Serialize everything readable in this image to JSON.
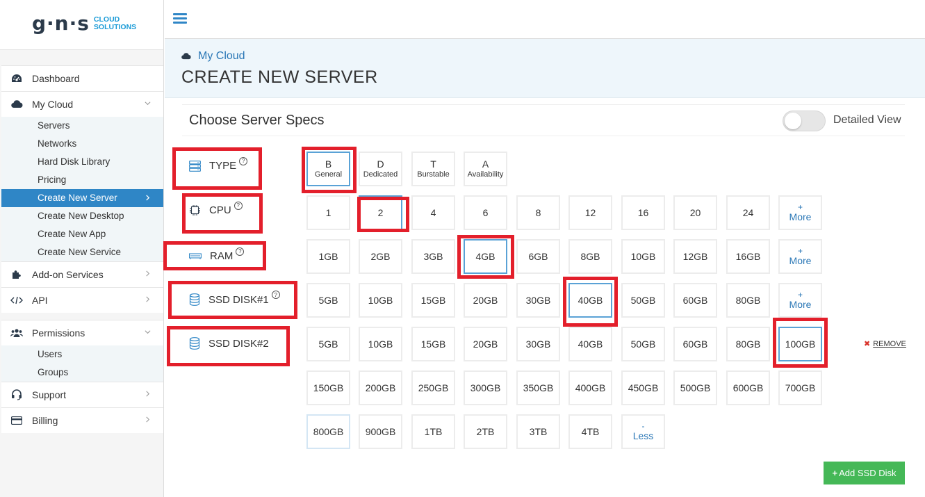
{
  "logo": {
    "brand": "g·n·s",
    "line1": "CLOUD",
    "line2": "SOLUTIONS"
  },
  "sidebar": {
    "items": [
      {
        "label": "Dashboard"
      },
      {
        "label": "My Cloud"
      },
      {
        "label": "Add-on Services"
      },
      {
        "label": "API"
      },
      {
        "label": "Permissions"
      },
      {
        "label": "Support"
      },
      {
        "label": "Billing"
      }
    ],
    "mycloud_sub": [
      "Servers",
      "Networks",
      "Hard Disk Library",
      "Pricing",
      "Create New Server",
      "Create New Desktop",
      "Create New App",
      "Create New Service"
    ],
    "permissions_sub": [
      "Users",
      "Groups"
    ]
  },
  "header": {
    "breadcrumb": "My Cloud",
    "title": "CREATE NEW SERVER"
  },
  "specs": {
    "title": "Choose Server Specs",
    "toggle_label": "Detailed View",
    "labels": {
      "type": "TYPE",
      "cpu": "CPU",
      "ram": "RAM",
      "ssd1": "SSD DISK#1",
      "ssd2": "SSD DISK#2"
    },
    "help": "?",
    "types": [
      {
        "letter": "B",
        "name": "General"
      },
      {
        "letter": "D",
        "name": "Dedicated"
      },
      {
        "letter": "T",
        "name": "Burstable"
      },
      {
        "letter": "A",
        "name": "Availability"
      }
    ],
    "cpu": [
      "1",
      "2",
      "4",
      "6",
      "8",
      "12",
      "16",
      "20",
      "24"
    ],
    "ram": [
      "1GB",
      "2GB",
      "3GB",
      "4GB",
      "6GB",
      "8GB",
      "10GB",
      "12GB",
      "16GB"
    ],
    "ssd1": [
      "5GB",
      "10GB",
      "15GB",
      "20GB",
      "30GB",
      "40GB",
      "50GB",
      "60GB",
      "80GB"
    ],
    "ssd2_row1": [
      "5GB",
      "10GB",
      "15GB",
      "20GB",
      "30GB",
      "40GB",
      "50GB",
      "60GB",
      "80GB",
      "100GB"
    ],
    "ssd2_row2": [
      "150GB",
      "200GB",
      "250GB",
      "300GB",
      "350GB",
      "400GB",
      "450GB",
      "500GB",
      "600GB",
      "700GB"
    ],
    "ssd2_row3": [
      "800GB",
      "900GB",
      "1TB",
      "2TB",
      "3TB",
      "4TB"
    ],
    "more": {
      "symbol": "+",
      "label": "More"
    },
    "less": {
      "symbol": "-",
      "label": "Less"
    },
    "remove": {
      "icon": "✖",
      "label": "REMOVE"
    },
    "add_button": {
      "icon": "+",
      "label": "Add SSD Disk"
    }
  },
  "colors": {
    "primary": "#2f86c6",
    "highlight": "#e31f2b",
    "success": "#45b857"
  }
}
